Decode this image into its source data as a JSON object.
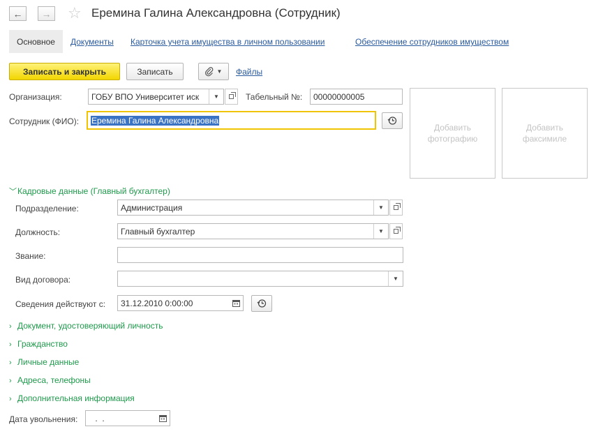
{
  "window": {
    "title": "Еремина Галина Александровна (Сотрудник)",
    "back_icon": "←",
    "forward_icon": "→",
    "favorite_icon": "☆"
  },
  "tabs": [
    {
      "label": "Основное",
      "active": true
    },
    {
      "label": "Документы"
    },
    {
      "label": "Карточка учета имущества в личном пользовании"
    },
    {
      "label": "Обеспечение сотрудников имуществом"
    }
  ],
  "toolbar": {
    "save_close_label": "Записать и закрыть",
    "save_label": "Записать",
    "attach_icon": "paperclip-icon",
    "files_label": "Файлы"
  },
  "form": {
    "org_label": "Организация:",
    "org_value": "ГОБУ ВПО Университет иск",
    "tabnum_label": "Табельный №:",
    "tabnum_value": "00000000005",
    "fio_label": "Сотрудник (ФИО):",
    "fio_value": "Еремина Галина Александровна",
    "add_photo": "Добавить фотографию",
    "add_facsimile": "Добавить факсимиле"
  },
  "hr_section": {
    "title": "Кадровые данные (Главный бухгалтер)",
    "department_label": "Подразделение:",
    "department_value": "Администрация",
    "position_label": "Должность:",
    "position_value": "Главный бухгалтер",
    "rank_label": "Звание:",
    "rank_value": "",
    "contract_label": "Вид договора:",
    "contract_value": "",
    "valid_from_label": "Сведения действуют с:",
    "valid_from_value": "31.12.2010  0:00:00"
  },
  "collapsed_sections": [
    "Документ, удостоверяющий личность",
    "Гражданство",
    "Личные данные",
    "Адреса, телефоны",
    "Дополнительная информация"
  ],
  "dismissal": {
    "label": "Дата увольнения:",
    "value": " .  ."
  },
  "colors": {
    "accent_green": "#1e9a4b",
    "link_blue": "#2a5a9e",
    "primary_yellow": "#f2d600",
    "selection_blue": "#3a72c4",
    "focus_border": "#f0c400"
  }
}
